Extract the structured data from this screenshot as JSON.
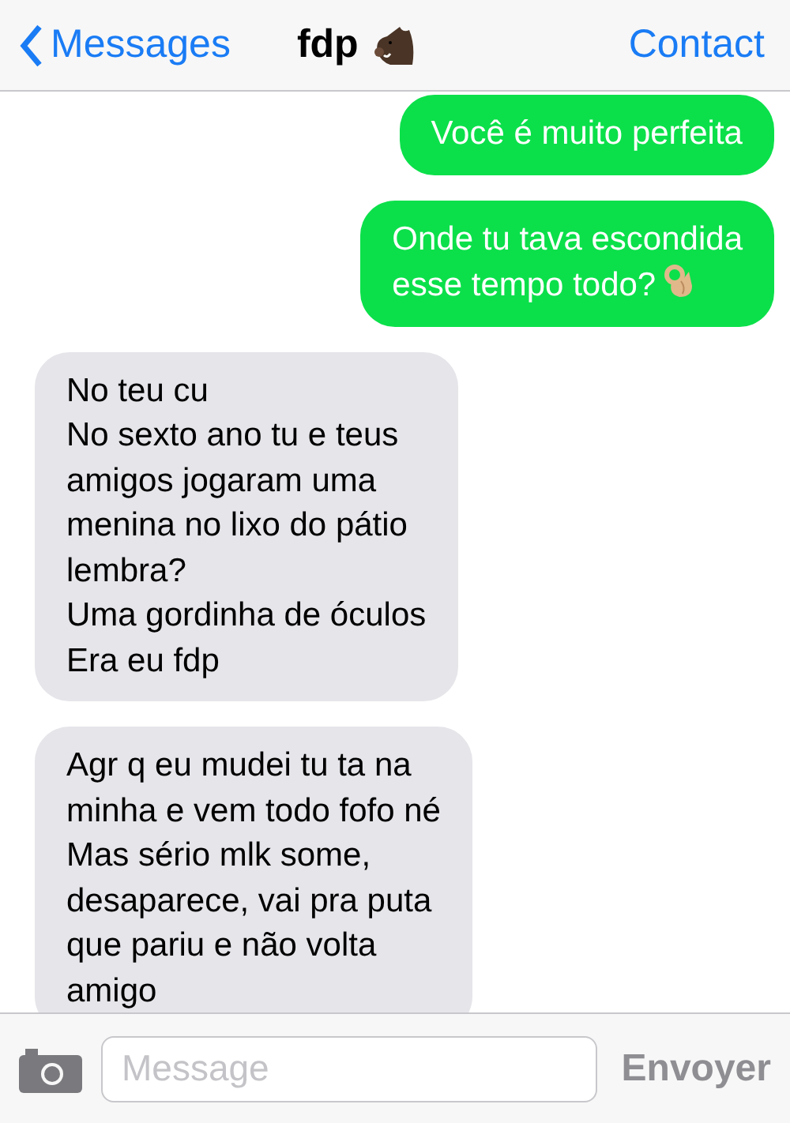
{
  "nav": {
    "back": "Messages",
    "title": "fdp",
    "action": "Contact"
  },
  "messages": [
    {
      "kind": "sent",
      "text": "Você é muito perfeita",
      "emoji": false
    },
    {
      "kind": "sent",
      "text": "Onde tu tava escondida\nesse tempo todo?",
      "emoji": true
    },
    {
      "kind": "received",
      "text": "No teu cu\nNo sexto ano tu e teus\namigos jogaram uma\nmenina no lixo do pátio\nlembra?\nUma gordinha de óculos\nEra eu fdp",
      "emoji": false
    },
    {
      "kind": "received",
      "text": "Agr q eu mudei tu ta na\nminha e vem todo fofo né\nMas sério mlk some,\ndesaparece, vai pra puta\nque pariu e não volta\namigo",
      "emoji": false
    }
  ],
  "composer": {
    "placeholder": "Message",
    "send": "Envoyer"
  }
}
